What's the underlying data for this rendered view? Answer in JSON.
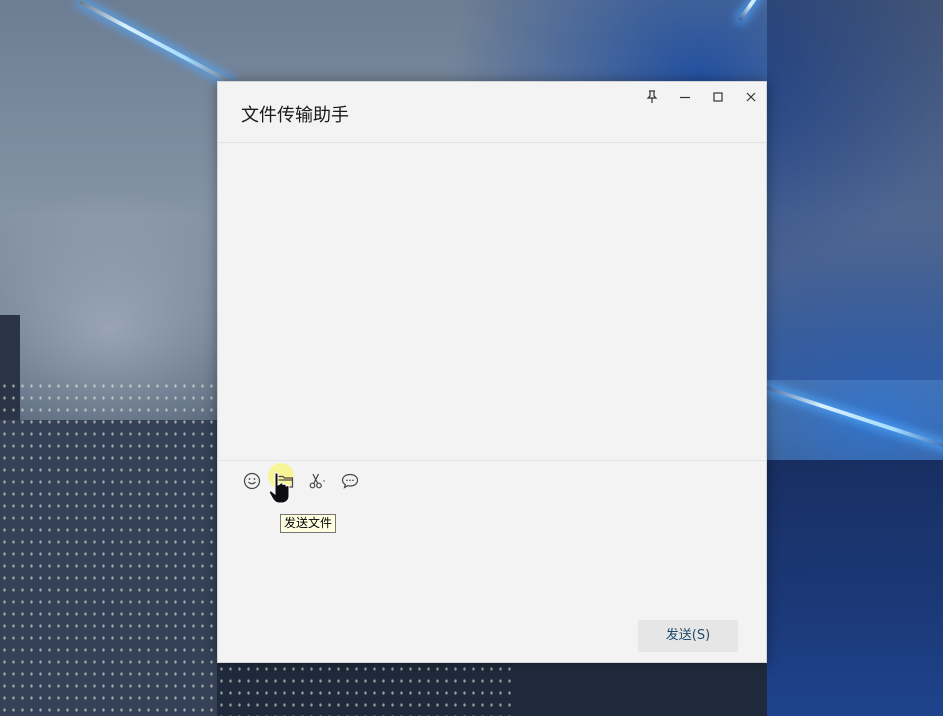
{
  "window": {
    "title": "文件传输助手"
  },
  "window_controls": {
    "pin_icon": "pin-icon",
    "minimize_icon": "minimize-icon",
    "maximize_icon": "maximize-icon",
    "close_icon": "close-icon"
  },
  "toolbar": {
    "emoji_icon": "emoji-icon",
    "file_icon": "folder-icon",
    "screenshot_icon": "scissors-icon",
    "chat_history_icon": "chat-bubble-icon",
    "tooltip": "发送文件"
  },
  "composer": {
    "send_label": "发送(S)"
  },
  "colors": {
    "window_bg": "#f3f3f3",
    "send_button_bg": "#e6e6e6",
    "send_button_text": "#1f4a6d",
    "tooltip_bg": "#ffffe1"
  }
}
